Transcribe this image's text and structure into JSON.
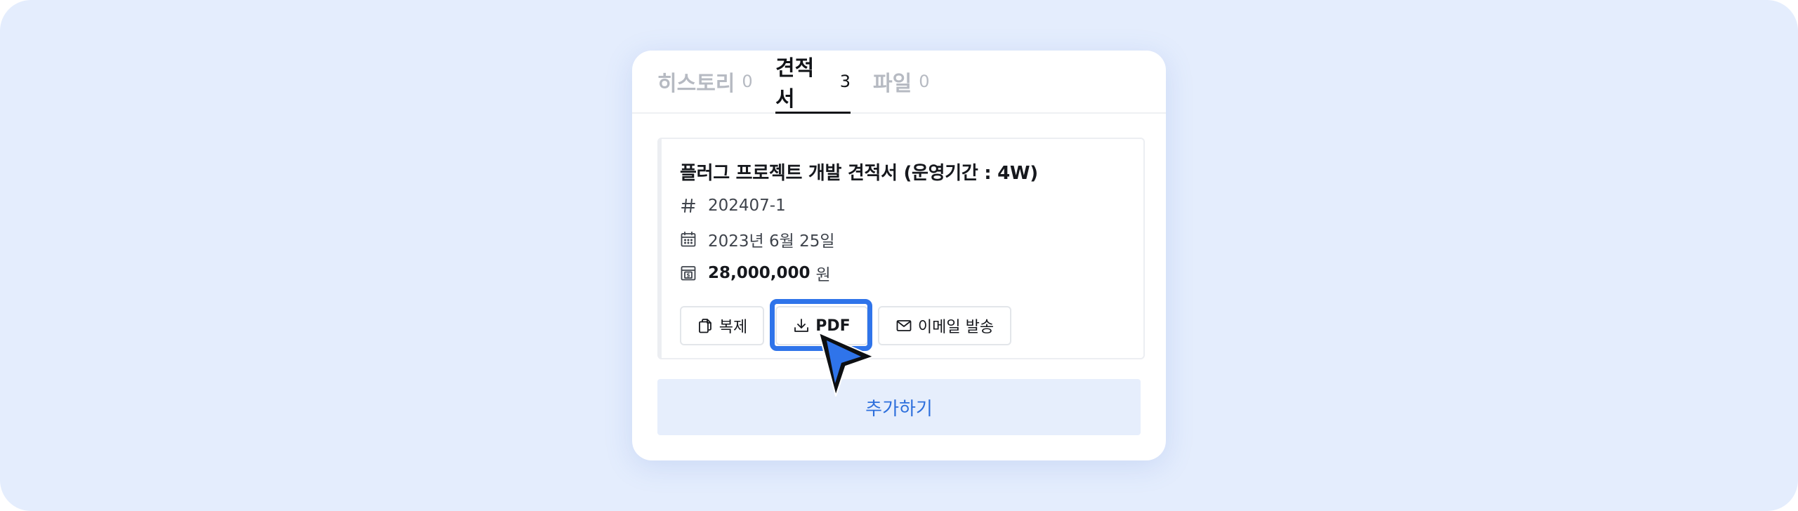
{
  "tabs": [
    {
      "label": "히스토리",
      "count": "0"
    },
    {
      "label": "견적서",
      "count": "3"
    },
    {
      "label": "파일",
      "count": "0"
    }
  ],
  "active_tab": "견적서",
  "estimate": {
    "title": "플러그 프로젝트 개발 견적서 (운영기간 : 4W)",
    "number_icon": "#",
    "number": "202407-1",
    "date": "2023년 6월 25일",
    "amount": "28,000,000",
    "amount_unit": "원"
  },
  "actions": {
    "copy_label": "복제",
    "pdf_label": "PDF",
    "email_label": "이메일 발송"
  },
  "add_label": "추가하기",
  "colors": {
    "background": "#e4edfd",
    "accent": "#2f74ea",
    "add_button_bg": "#e6eefc",
    "add_button_text": "#2d6fdc"
  },
  "icons": {
    "number": "hash-icon",
    "date": "calendar-icon",
    "amount": "dollar-receipt-icon",
    "copy": "copy-icon",
    "pdf": "download-icon",
    "email": "mail-icon",
    "cursor": "cursor-arrow-icon"
  }
}
